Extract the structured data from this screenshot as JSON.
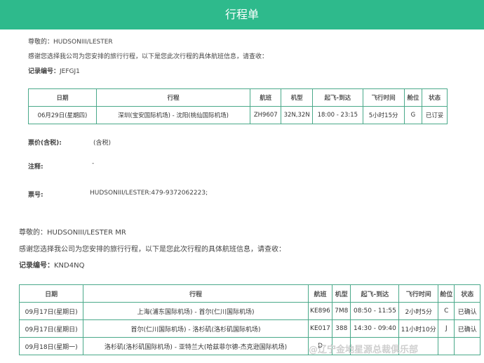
{
  "header": {
    "title": "行程单"
  },
  "itinerary1": {
    "greeting": "尊敬的：HUDSONIII/LESTER",
    "intro": "感谢您选择我公司为您安排的旅行行程，以下是您此次行程的具体航班信息，请查收：",
    "record_label": "记录编号：",
    "record_value": "JEFGJ1",
    "columns": [
      "日期",
      "行程",
      "航班",
      "机型",
      "起飞-到达",
      "飞行时间",
      "舱位",
      "状态"
    ],
    "rows": [
      [
        "06月29日(星期四)",
        "深圳(宝安国际机场) - 沈阳(桃仙国际机场)",
        "ZH9607",
        "32N,32N",
        "18:00 - 23:15",
        "5小时15分",
        "G",
        "已订妥"
      ]
    ],
    "fare_label": "票价(含税):",
    "fare_value": "(含税)",
    "note_label": "注释:",
    "note_value": "-",
    "ticket_label": "票号:",
    "ticket_value": "HUDSONIII/LESTER:479-9372062223;"
  },
  "itinerary2": {
    "greeting": "尊敬的：HUDSONIII/LESTER MR",
    "intro": "感谢您选择我公司为您安排的旅行行程，以下是您此次行程的具体航班信息，请查收：",
    "record_label": "记录编号：",
    "record_value": "KND4NQ",
    "columns": [
      "日期",
      "行程",
      "航班",
      "机型",
      "起飞-到达",
      "飞行时间",
      "舱位",
      "状态"
    ],
    "rows": [
      [
        "09月17日(星期日)",
        "上海(浦东国际机场) - 首尔(仁川国际机场)",
        "KE896",
        "7M8",
        "08:50 - 11:55",
        "2小时5分",
        "C",
        "已确认"
      ],
      [
        "09月17日(星期日)",
        "首尔(仁川国际机场) - 洛杉矶(洛杉矶国际机场)",
        "KE017",
        "388",
        "14:30 - 09:40",
        "11小时10分",
        "J",
        "已确认"
      ],
      [
        "09月18日(星期一)",
        "洛杉矶(洛杉矶国际机场) - 亚特兰大(哈兹菲尔德-杰克逊国际机场)",
        "D",
        "",
        "",
        "",
        "",
        ""
      ]
    ]
  },
  "watermark": "@辽宁金地星源总裁俱乐部"
}
